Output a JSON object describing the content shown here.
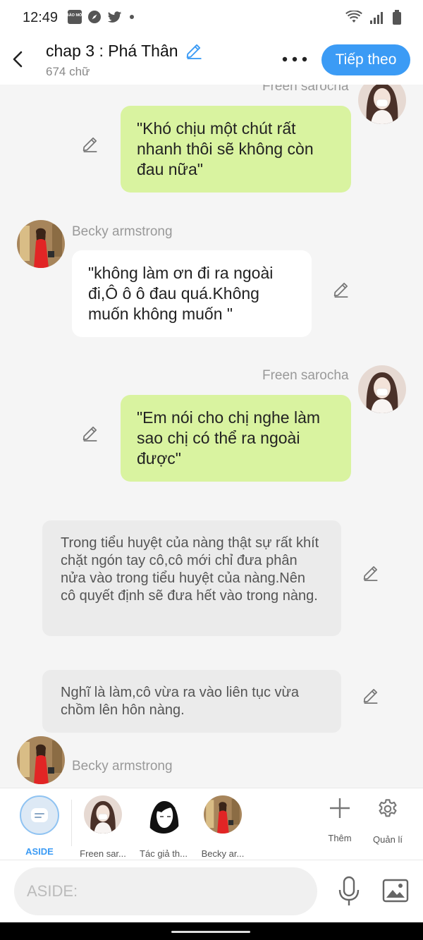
{
  "status_bar": {
    "time": "12:49",
    "baomoi_badge": "BÁO MỚI"
  },
  "header": {
    "title": "chap 3 : Phá Thân",
    "word_count": "674 chữ",
    "next_button": "Tiếp theo"
  },
  "messages": [
    {
      "sender": "Freen sarocha",
      "text": "\"Khó chịu một chút rất nhanh thôi sẽ không còn đau nữa\""
    },
    {
      "sender": "Becky armstrong",
      "text": "\"không làm ơn đi ra ngoài đi,Ô ô ô đau quá.Không muốn không muốn \""
    },
    {
      "sender": "Freen sarocha",
      "text": "\"Em nói cho chị nghe làm sao chị có thể ra ngoài được\""
    },
    {
      "text": "Trong tiểu huyệt của nàng thật sự rất khít chặt ngón tay cô,cô mới chỉ đưa phân nửa vào trong tiểu huyệt của nàng.Nên cô quyết định sẽ đưa hết vào trong nàng."
    },
    {
      "text": "Nghĩ là làm,cô vừa ra vào liên tục vừa chồm lên hôn nàng."
    },
    {
      "sender": "Becky armstrong"
    }
  ],
  "characters": [
    {
      "label": "ASIDE"
    },
    {
      "label": "Freen sar..."
    },
    {
      "label": "Tác giả th..."
    },
    {
      "label": "Becky ar..."
    }
  ],
  "tools": {
    "add_label": "Thêm",
    "manage_label": "Quản lí"
  },
  "input": {
    "placeholder": "ASIDE:"
  },
  "colors": {
    "accent": "#3b9bf5",
    "speaker_bubble": "#d9f3a0",
    "narration_bg": "#ebebeb"
  }
}
